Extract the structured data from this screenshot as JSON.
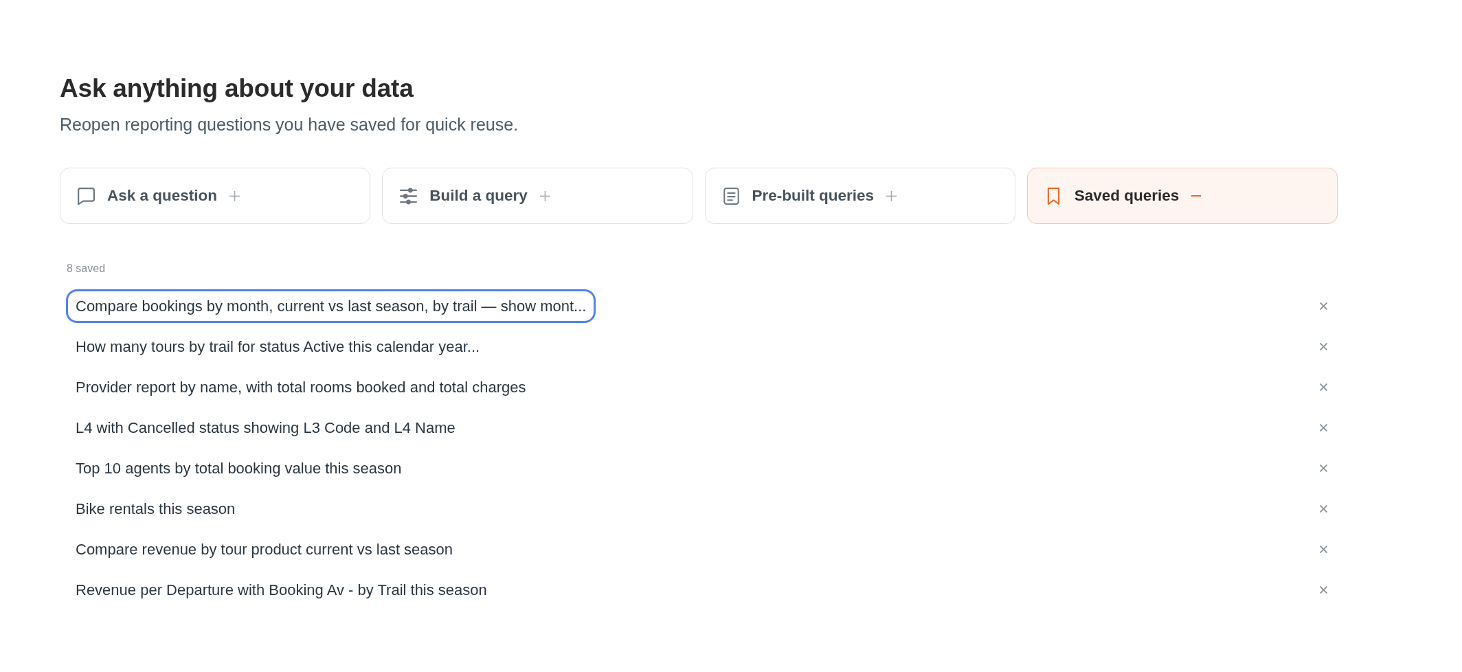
{
  "header": {
    "title": "Ask anything about your data",
    "subtitle": "Reopen reporting questions you have saved for quick reuse."
  },
  "tabs": [
    {
      "label": "Ask a question",
      "selected": false,
      "expanded": false
    },
    {
      "label": "Build a query",
      "selected": false,
      "expanded": false
    },
    {
      "label": "Pre-built queries",
      "selected": false,
      "expanded": false
    },
    {
      "label": "Saved queries",
      "selected": true,
      "expanded": true
    }
  ],
  "saved": {
    "count_label": "8 saved",
    "queries": [
      {
        "text": "Compare bookings by month, current vs last season, by trail — show mont...",
        "focused": true
      },
      {
        "text": "How many tours by trail for status Active this calendar year...",
        "focused": false
      },
      {
        "text": "Provider report by name, with total rooms booked and total charges",
        "focused": false
      },
      {
        "text": "L4 with Cancelled status showing L3 Code and L4 Name",
        "focused": false
      },
      {
        "text": "Top 10 agents by total booking value this season",
        "focused": false
      },
      {
        "text": "Bike rentals this season",
        "focused": false
      },
      {
        "text": "Compare revenue by tour product current vs last season",
        "focused": false
      },
      {
        "text": "Revenue per Departure with Booking Av - by Trail this season",
        "focused": false
      }
    ]
  }
}
